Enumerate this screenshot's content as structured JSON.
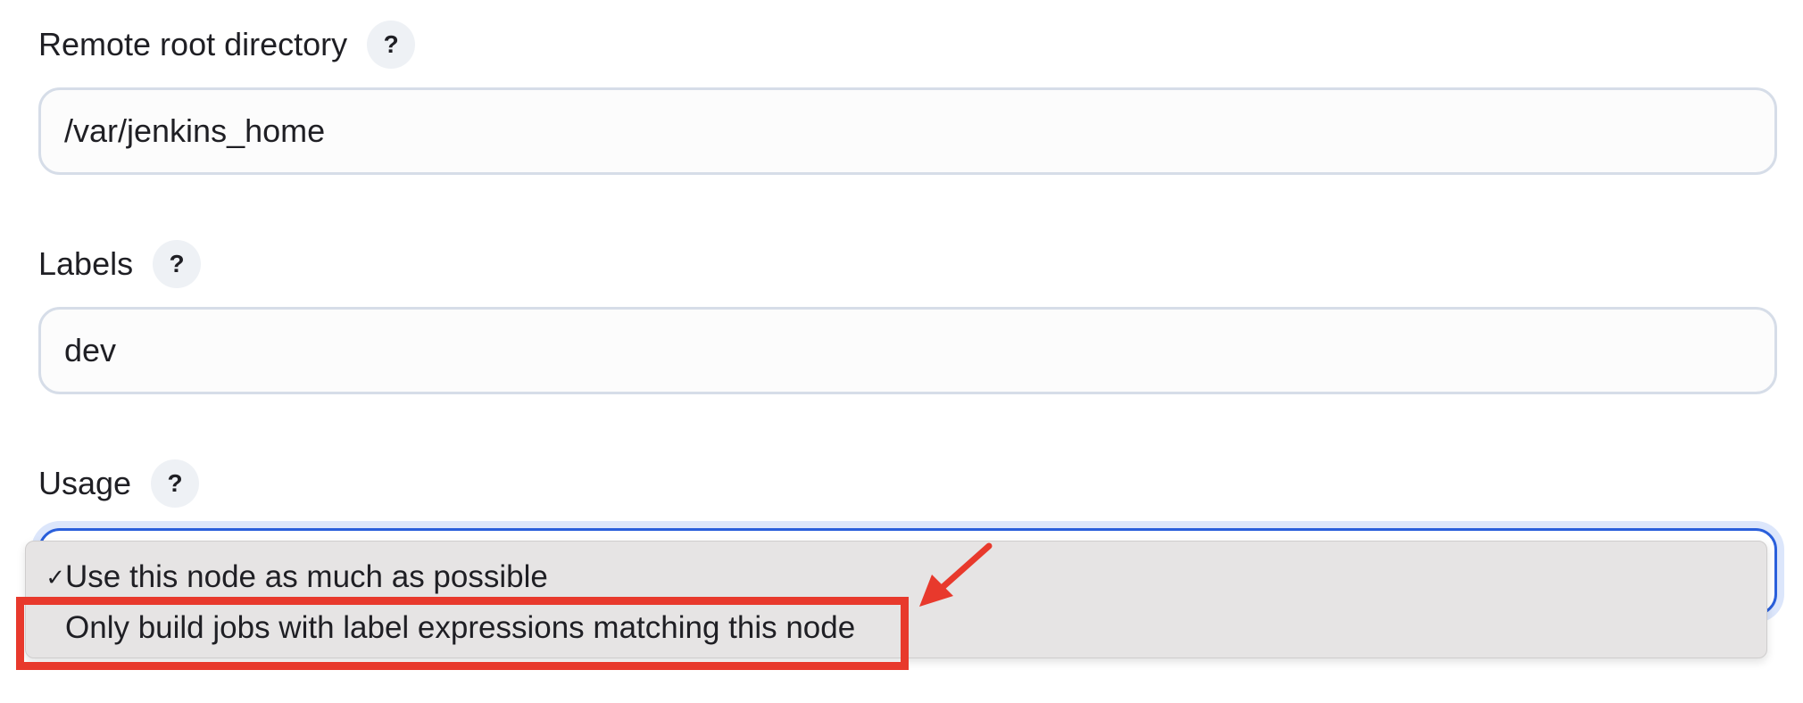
{
  "fields": {
    "remote_root": {
      "label": "Remote root directory",
      "help": "?",
      "value": "/var/jenkins_home"
    },
    "labels": {
      "label": "Labels",
      "help": "?",
      "value": "dev"
    },
    "usage": {
      "label": "Usage",
      "help": "?",
      "options": [
        {
          "label": "Use this node as much as possible",
          "selected": true,
          "check": "✓"
        },
        {
          "label": "Only build jobs with label expressions matching this node",
          "selected": false,
          "check": ""
        }
      ]
    }
  },
  "annotation": {
    "color": "#e8392c",
    "target": "Only build jobs with label expressions matching this node"
  },
  "colors": {
    "focus_border": "#2a5fdb",
    "input_border": "#d6dde8",
    "dropdown_bg": "#e6e4e4"
  }
}
